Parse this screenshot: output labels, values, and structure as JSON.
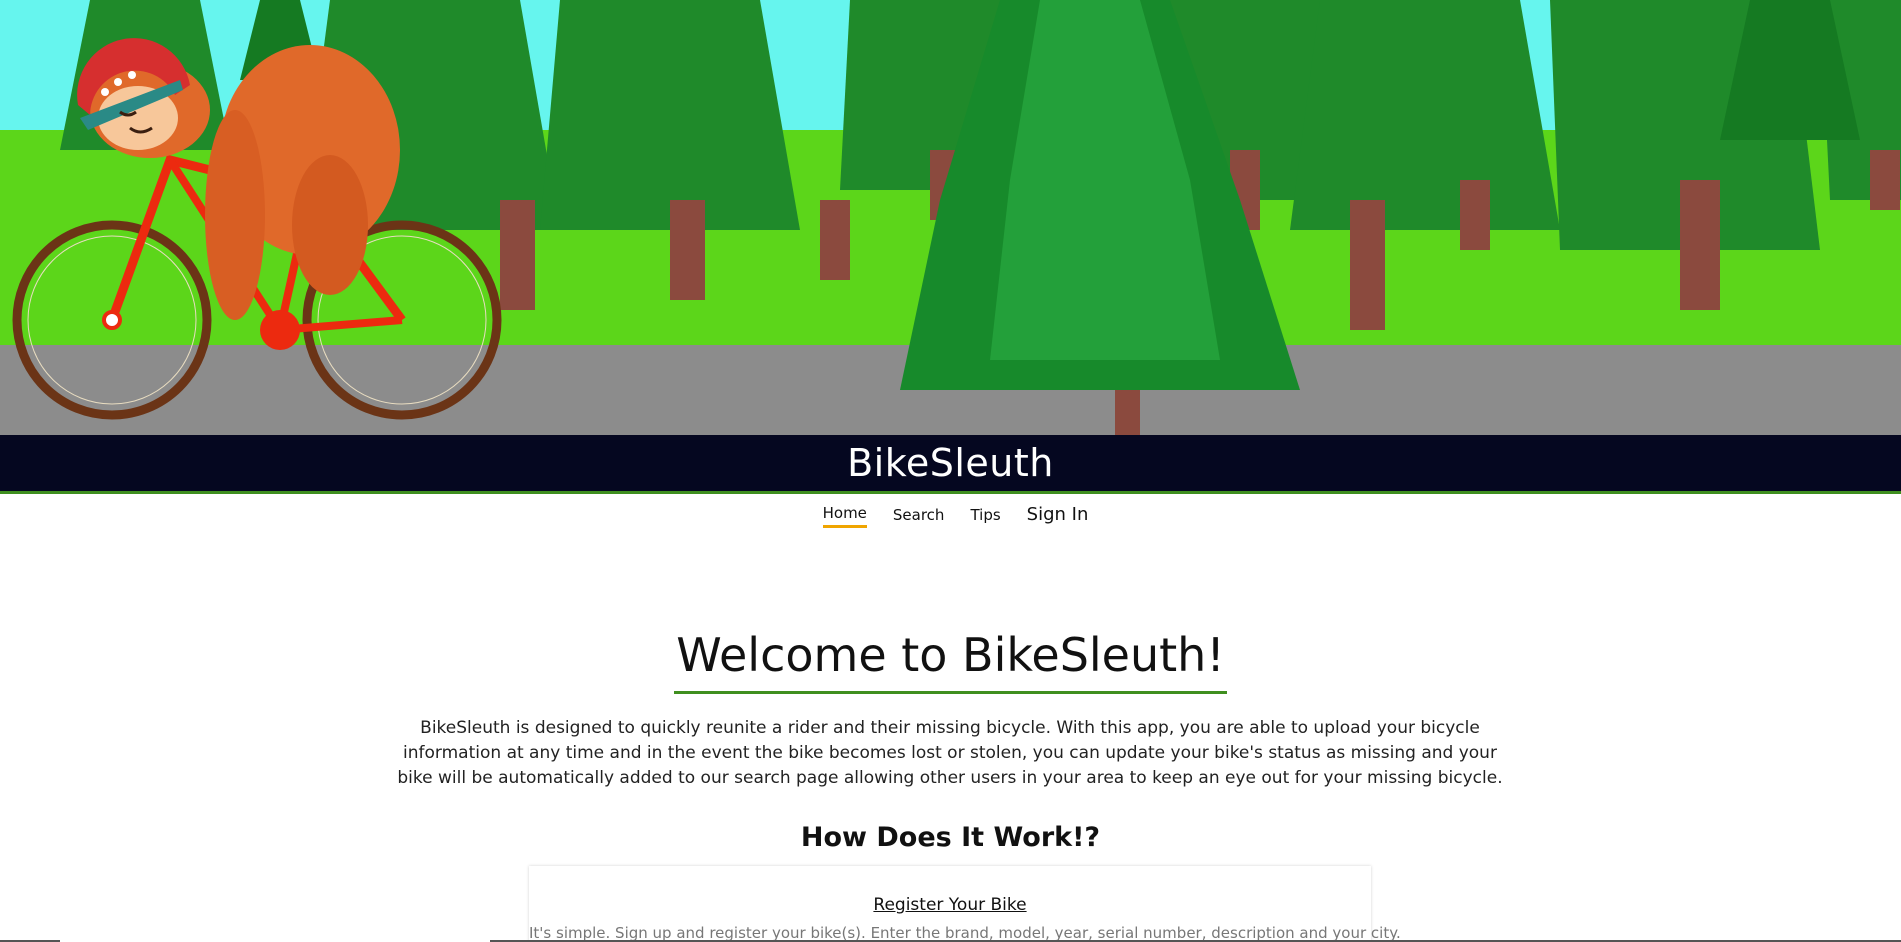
{
  "header": {
    "site_title": "BikeSleuth",
    "hero_image": "sloth-riding-bicycle-forest-illustration"
  },
  "nav": {
    "items": [
      {
        "label": "Home",
        "active": true
      },
      {
        "label": "Search",
        "active": false
      },
      {
        "label": "Tips",
        "active": false
      },
      {
        "label": "Sign In",
        "active": false
      }
    ]
  },
  "main": {
    "welcome_title": "Welcome to BikeSleuth!",
    "intro": "BikeSleuth is designed to quickly reunite a rider and their missing bicycle. With this app, you are able to upload your bicycle information at any time and in the event the bike becomes lost or stolen, you can update your bike's status as missing and your bike will be automatically added to our search page allowing other users in your area to keep an eye out for your missing bicycle.",
    "how_title": "How Does It Work!?",
    "steps": [
      {
        "title": "Register Your Bike",
        "text": "It's simple. Sign up and register your bike(s). Enter the brand, model, year, serial number, description and your city."
      }
    ]
  },
  "colors": {
    "title_bar": "#050720",
    "accent_green": "#3f8f1f",
    "active_underline": "#f0a500"
  }
}
